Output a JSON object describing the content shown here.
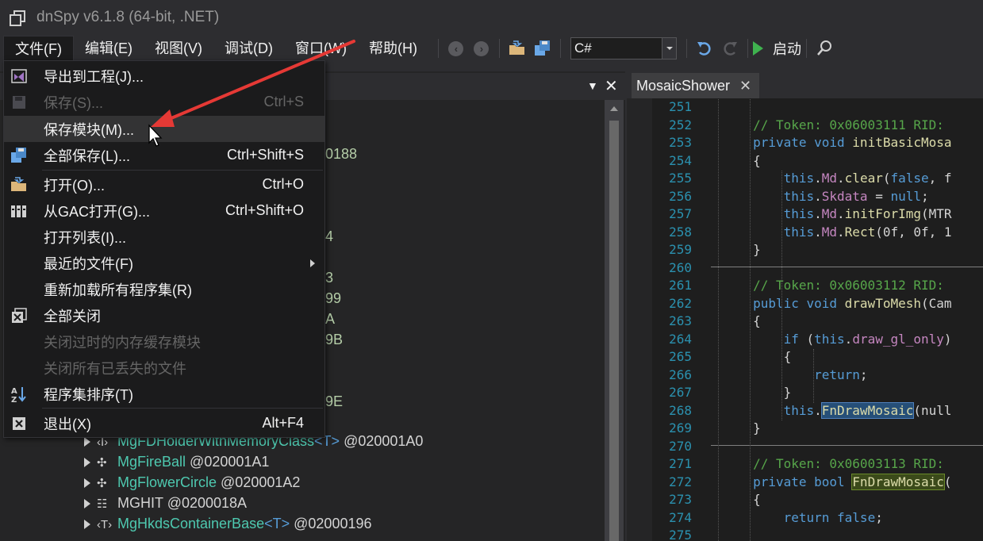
{
  "title": "dnSpy v6.1.8 (64-bit, .NET)",
  "menu": {
    "file": "文件(F)",
    "edit": "编辑(E)",
    "view": "视图(V)",
    "debug": "调试(D)",
    "window": "窗口(W)",
    "help": "帮助(H)"
  },
  "toolbar": {
    "language": "C#",
    "run_label": "启动"
  },
  "file_menu": {
    "items": [
      {
        "label": "导出到工程(J)...",
        "shortcut": "",
        "disabled": false
      },
      {
        "label": "保存(S)...",
        "shortcut": "Ctrl+S",
        "disabled": true
      },
      {
        "label": "保存模块(M)...",
        "shortcut": "",
        "disabled": false
      },
      {
        "label": "全部保存(L)...",
        "shortcut": "Ctrl+Shift+S",
        "disabled": false
      },
      {
        "label": "打开(O)...",
        "shortcut": "Ctrl+O",
        "disabled": false
      },
      {
        "label": "从GAC打开(G)...",
        "shortcut": "Ctrl+Shift+O",
        "disabled": false
      },
      {
        "label": "打开列表(I)...",
        "shortcut": "",
        "disabled": false
      },
      {
        "label": "最近的文件(F)",
        "shortcut": "",
        "disabled": false
      },
      {
        "label": "重新加载所有程序集(R)",
        "shortcut": "",
        "disabled": false
      },
      {
        "label": "全部关闭",
        "shortcut": "",
        "disabled": false
      },
      {
        "label": "关闭过时的内存缓存模块",
        "shortcut": "",
        "disabled": true
      },
      {
        "label": "关闭所有已丢失的文件",
        "shortcut": "",
        "disabled": true
      },
      {
        "label": "程序集排序(T)",
        "shortcut": "",
        "disabled": false
      },
      {
        "label": "退出(X)",
        "shortcut": "Alt+F4",
        "disabled": false
      }
    ]
  },
  "tree": {
    "fragments": [
      "0188",
      "4",
      "3",
      "99",
      "A",
      "9B",
      "9E"
    ],
    "rows": [
      {
        "name": "MgFDHolderWithMemoryClass",
        "generic": "<T>",
        "token": "@020001A0"
      },
      {
        "name": "MgFireBall",
        "generic": "",
        "token": "@020001A1"
      },
      {
        "name": "MgFlowerCircle",
        "generic": "",
        "token": "@020001A2"
      },
      {
        "name": "MGHIT",
        "generic": "",
        "token": "@0200018A"
      },
      {
        "name": "MgHkdsContainerBase",
        "generic": "<T>",
        "token": "@02000196"
      }
    ]
  },
  "editor": {
    "tab_label": "MosaicShower",
    "lines": [
      {
        "n": "251",
        "parts": []
      },
      {
        "n": "252",
        "parts": [
          [
            "c-cm",
            "        // Token: 0x06003111 RID:"
          ]
        ]
      },
      {
        "n": "253",
        "parts": [
          [
            "c-kw",
            "        private void "
          ],
          [
            "c-fn",
            "initBasicMosa"
          ]
        ]
      },
      {
        "n": "254",
        "parts": [
          [
            "c-txt",
            "        {"
          ]
        ]
      },
      {
        "n": "255",
        "parts": [
          [
            "c-kw",
            "            this"
          ],
          [
            "c-txt",
            "."
          ],
          [
            "c-fld",
            "Md"
          ],
          [
            "c-txt",
            "."
          ],
          [
            "c-fn",
            "clear"
          ],
          [
            "c-txt",
            "("
          ],
          [
            "c-kw",
            "false"
          ],
          [
            "c-txt",
            ", f"
          ]
        ]
      },
      {
        "n": "256",
        "parts": [
          [
            "c-kw",
            "            this"
          ],
          [
            "c-txt",
            "."
          ],
          [
            "c-fld",
            "Skdata"
          ],
          [
            "c-txt",
            " = "
          ],
          [
            "c-kw",
            "null"
          ],
          [
            "c-txt",
            ";"
          ]
        ]
      },
      {
        "n": "257",
        "parts": [
          [
            "c-kw",
            "            this"
          ],
          [
            "c-txt",
            "."
          ],
          [
            "c-fld",
            "Md"
          ],
          [
            "c-txt",
            "."
          ],
          [
            "c-fn",
            "initForImg"
          ],
          [
            "c-txt",
            "(MTR"
          ]
        ]
      },
      {
        "n": "258",
        "parts": [
          [
            "c-kw",
            "            this"
          ],
          [
            "c-txt",
            "."
          ],
          [
            "c-fld",
            "Md"
          ],
          [
            "c-txt",
            "."
          ],
          [
            "c-fn",
            "Rect"
          ],
          [
            "c-txt",
            "(0f, 0f, 1"
          ]
        ]
      },
      {
        "n": "259",
        "parts": [
          [
            "c-txt",
            "        }"
          ]
        ]
      },
      {
        "n": "260",
        "parts": []
      },
      {
        "n": "261",
        "parts": [
          [
            "c-cm",
            "        // Token: 0x06003112 RID:"
          ]
        ]
      },
      {
        "n": "262",
        "parts": [
          [
            "c-kw",
            "        public void "
          ],
          [
            "c-fn",
            "drawToMesh"
          ],
          [
            "c-txt",
            "(Cam"
          ]
        ]
      },
      {
        "n": "263",
        "parts": [
          [
            "c-txt",
            "        {"
          ]
        ]
      },
      {
        "n": "264",
        "parts": [
          [
            "c-kw",
            "            if "
          ],
          [
            "c-txt",
            "("
          ],
          [
            "c-kw",
            "this"
          ],
          [
            "c-txt",
            "."
          ],
          [
            "c-fld",
            "draw_gl_only"
          ],
          [
            "c-txt",
            ")"
          ]
        ]
      },
      {
        "n": "265",
        "parts": [
          [
            "c-txt",
            "            {"
          ]
        ]
      },
      {
        "n": "266",
        "parts": [
          [
            "c-kw",
            "                return"
          ],
          [
            "c-txt",
            ";"
          ]
        ]
      },
      {
        "n": "267",
        "parts": [
          [
            "c-txt",
            "            }"
          ]
        ]
      },
      {
        "n": "268",
        "parts": [
          [
            "c-kw",
            "            this"
          ],
          [
            "c-txt",
            "."
          ],
          [
            "c-fn c-hl",
            "FnDrawMosaic"
          ],
          [
            "c-txt",
            "(null"
          ]
        ]
      },
      {
        "n": "269",
        "parts": [
          [
            "c-txt",
            "        }"
          ]
        ]
      },
      {
        "n": "270",
        "parts": []
      },
      {
        "n": "271",
        "parts": [
          [
            "c-cm",
            "        // Token: 0x06003113 RID:"
          ]
        ]
      },
      {
        "n": "272",
        "parts": [
          [
            "c-kw",
            "        private bool "
          ],
          [
            "c-fn c-hl2",
            "FnDrawMosaic"
          ],
          [
            "c-txt",
            "("
          ]
        ]
      },
      {
        "n": "273",
        "parts": [
          [
            "c-txt",
            "        {"
          ]
        ]
      },
      {
        "n": "274",
        "parts": [
          [
            "c-kw",
            "            return "
          ],
          [
            "c-kw",
            "false"
          ],
          [
            "c-txt",
            ";"
          ]
        ]
      },
      {
        "n": "275",
        "parts": []
      }
    ]
  },
  "colors": {
    "accent_arrow": "#e53935",
    "background": "#2d2d30",
    "editor_bg": "#1e1e1e"
  }
}
